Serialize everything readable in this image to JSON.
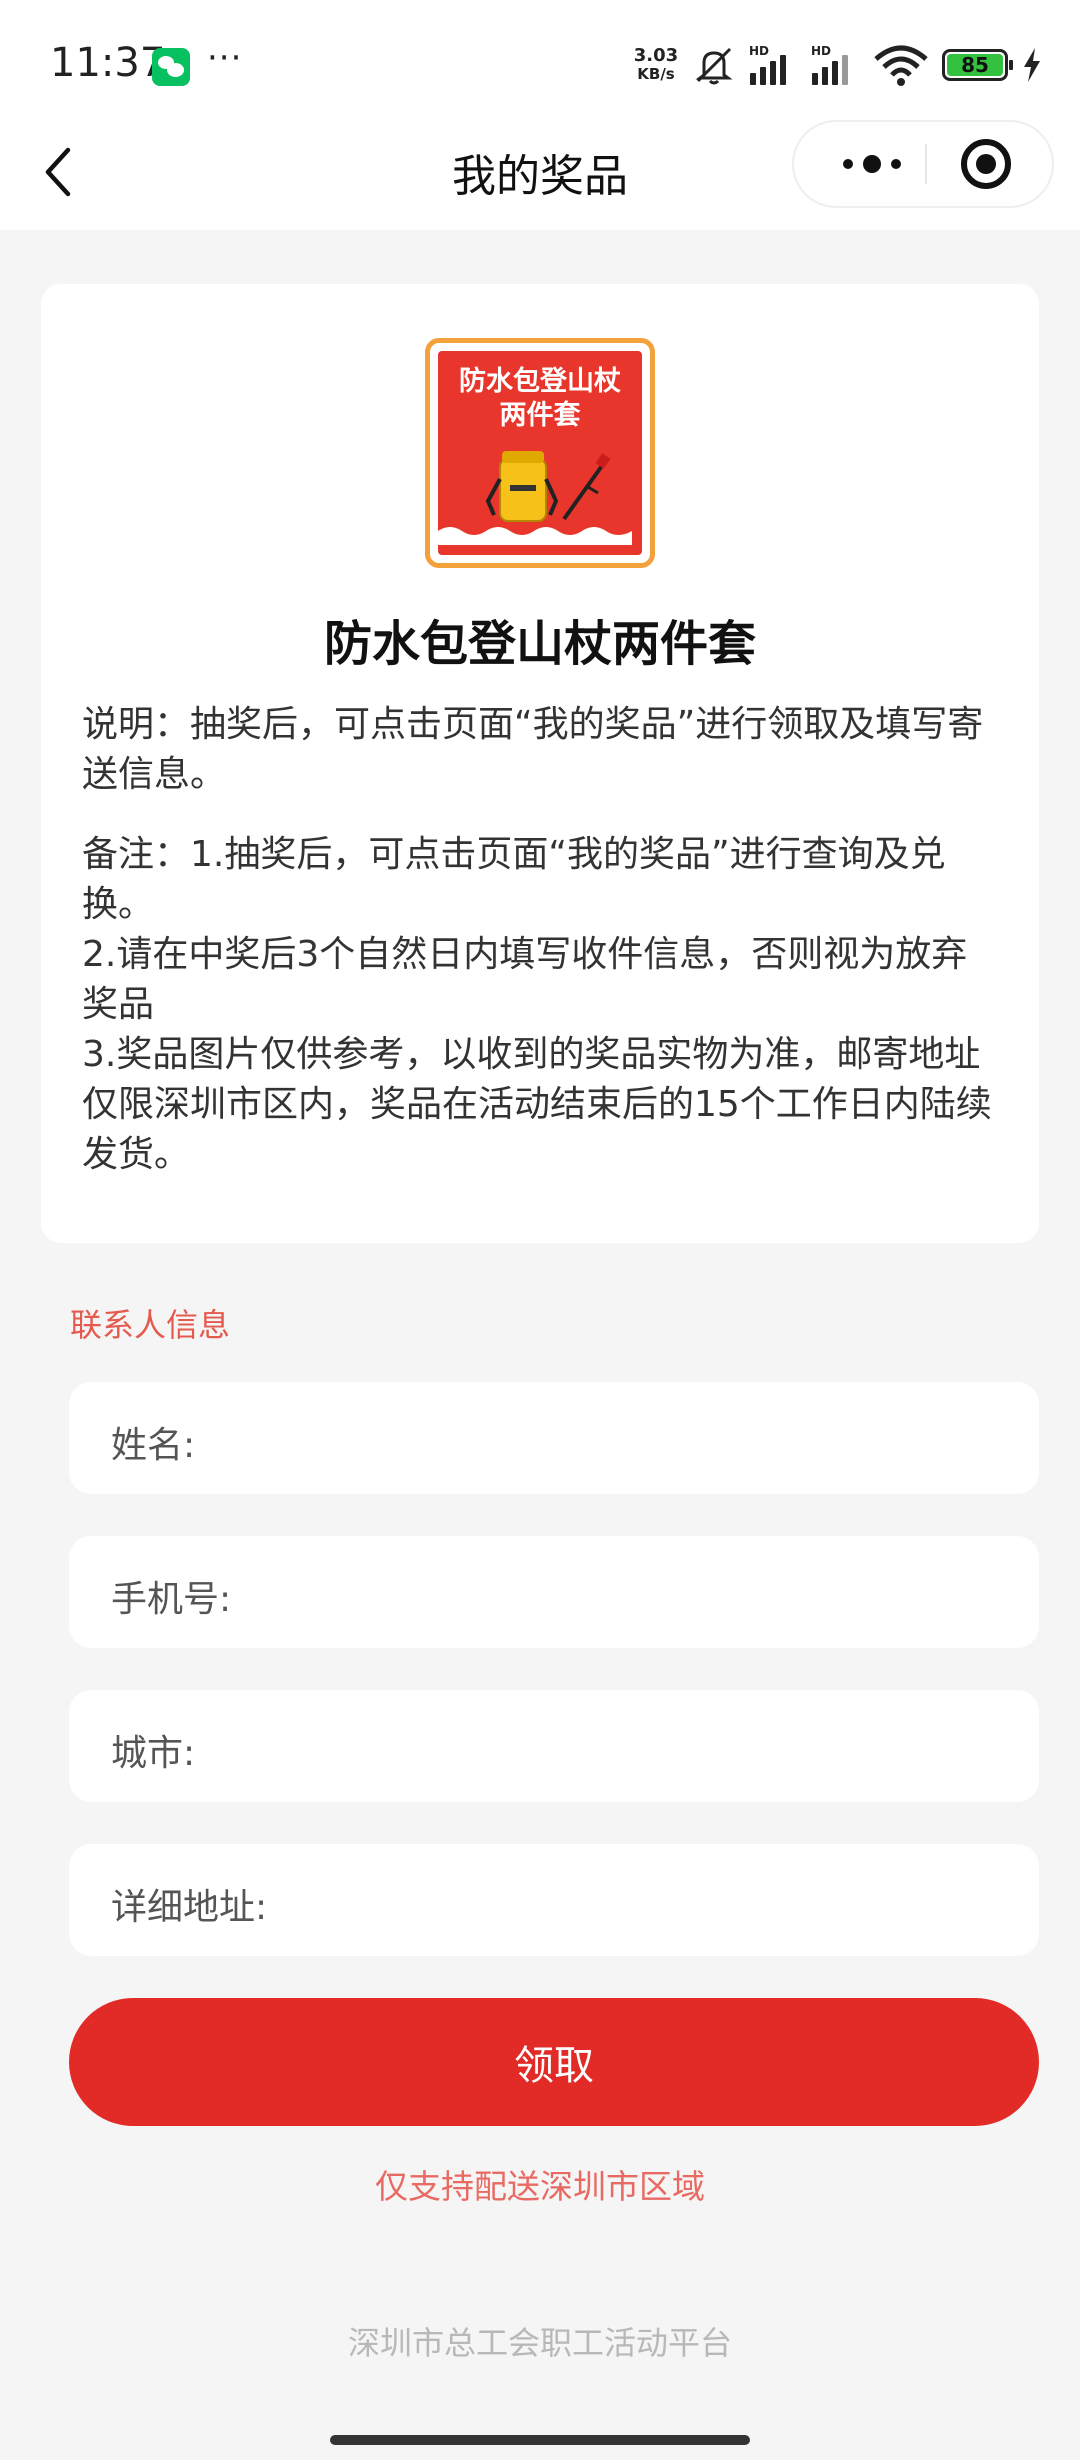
{
  "status_bar": {
    "time": "11:37",
    "more": "···",
    "net_speed_value": "3.03",
    "net_speed_unit": "KB/s",
    "hd1": "HD",
    "hd2": "HD",
    "battery": "85",
    "icons": [
      "wechat-icon",
      "mute-icon",
      "signal-icon",
      "wifi-icon",
      "battery-icon",
      "charging-icon"
    ]
  },
  "navbar": {
    "title": "我的奖品",
    "icons": [
      "back-arrow-icon",
      "more-dots-icon",
      "close-target-icon"
    ]
  },
  "prize": {
    "thumb_text_line1": "防水包登山杖",
    "thumb_text_line2": "两件套",
    "name": "防水包登山杖两件套",
    "description": "说明：抽奖后，可点击页面“我的奖品”进行领取及填写寄送信息。",
    "notes": [
      "备注：1.抽奖后，可点击页面“我的奖品”进行查询及兑换。",
      "2.请在中奖后3个自然日内填写收件信息，否则视为放弃奖品",
      "3.奖品图片仅供参考，以收到的奖品实物为准，邮寄地址仅限深圳市区内，奖品在活动结束后的15个工作日内陆续发货。"
    ]
  },
  "contact": {
    "section_title": "联系人信息",
    "fields": [
      {
        "label": "姓名:",
        "value": ""
      },
      {
        "label": "手机号:",
        "value": ""
      },
      {
        "label": "城市:",
        "value": ""
      },
      {
        "label": "详细地址:",
        "value": ""
      }
    ]
  },
  "claim_button": "领取",
  "region_note": "仅支持配送深圳市区域",
  "footer": "深圳市总工会职工活动平台",
  "colors": {
    "accent_red": "#e22b27",
    "hint_red": "#e86a62",
    "thumb_border": "#f3a13a",
    "background": "#f5f5f5"
  }
}
